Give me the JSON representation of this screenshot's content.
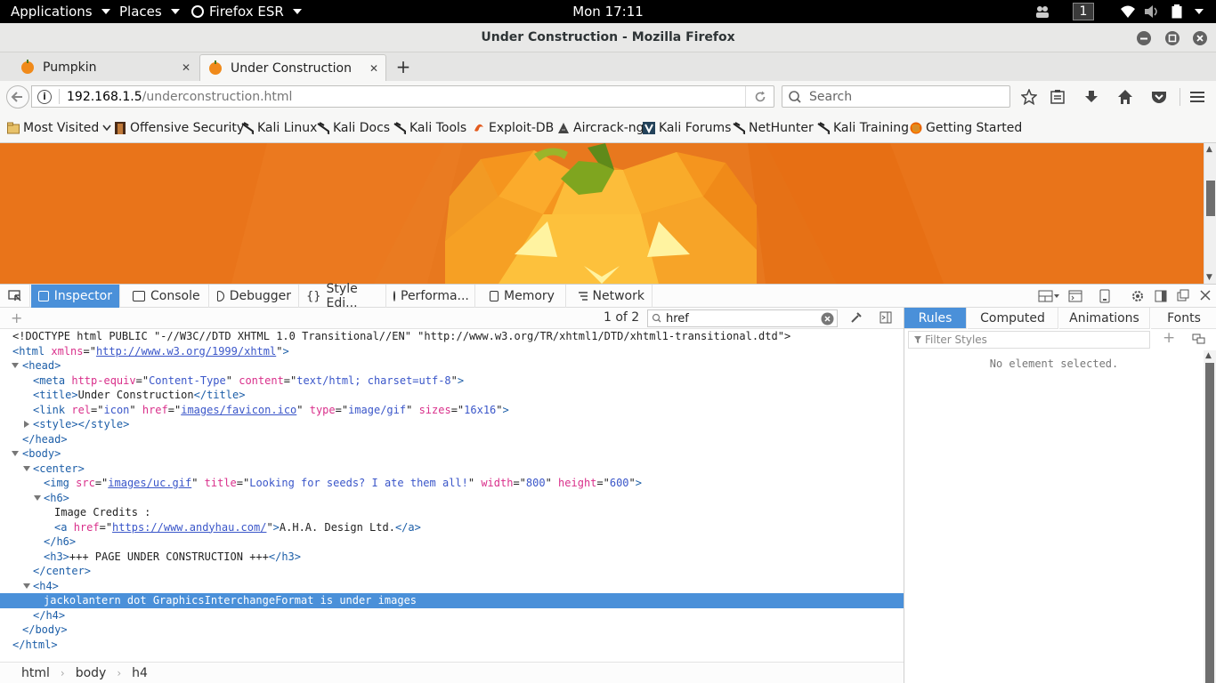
{
  "gnome": {
    "applications": "Applications",
    "places": "Places",
    "firefox_menu": "Firefox ESR",
    "clock": "Mon 17:11",
    "workspace": "1"
  },
  "window": {
    "title": "Under Construction - Mozilla Firefox"
  },
  "tabs": [
    {
      "label": "Pumpkin",
      "active": false
    },
    {
      "label": "Under Construction",
      "active": true
    }
  ],
  "navbar": {
    "url_host": "192.168.1.5",
    "url_path": "/underconstruction.html",
    "search_placeholder": "Search"
  },
  "bookmarks": [
    {
      "label": "Most Visited",
      "icon": "folder-icon"
    },
    {
      "label": "Offensive Security",
      "icon": "offsec-icon"
    },
    {
      "label": "Kali Linux",
      "icon": "kali-icon"
    },
    {
      "label": "Kali Docs",
      "icon": "kali-icon"
    },
    {
      "label": "Kali Tools",
      "icon": "kali-icon"
    },
    {
      "label": "Exploit-DB",
      "icon": "exploitdb-icon"
    },
    {
      "label": "Aircrack-ng",
      "icon": "aircrack-icon"
    },
    {
      "label": "Kali Forums",
      "icon": "kali-forums-icon"
    },
    {
      "label": "NetHunter",
      "icon": "kali-icon"
    },
    {
      "label": "Kali Training",
      "icon": "kali-icon"
    },
    {
      "label": "Getting Started",
      "icon": "firefox-icon"
    }
  ],
  "devtools": {
    "tabs": [
      "Inspector",
      "Console",
      "Debugger",
      "Style Edi...",
      "Performa...",
      "Memory",
      "Network"
    ],
    "search_count": "1 of 2",
    "search_value": "href",
    "markup": {
      "doctype": "<!DOCTYPE html PUBLIC \"-//W3C//DTD XHTML 1.0 Transitional//EN\" \"http://www.w3.org/TR/xhtml1/DTD/xhtml1-transitional.dtd\">",
      "html_xmlns": "http://www.w3.org/1999/xhtml",
      "meta_http_equiv": "Content-Type",
      "meta_content": "text/html; charset=utf-8",
      "title_text": "Under Construction",
      "link_rel": "icon",
      "link_href": "images/favicon.ico",
      "link_type": "image/gif",
      "link_sizes": "16x16",
      "img_src": "images/uc.gif",
      "img_title": "Looking for seeds? I ate them all!",
      "img_width": "800",
      "img_height": "600",
      "h6_text": "Image Credits :",
      "a_href": "https://www.andyhau.com/",
      "a_text": "A.H.A. Design Ltd.",
      "h3_text": "+++ PAGE UNDER CONSTRUCTION +++",
      "h4_text": "jackolantern dot GraphicsInterchangeFormat is under images"
    },
    "breadcrumbs": [
      "html",
      "body",
      "h4"
    ],
    "side_tabs": [
      "Rules",
      "Computed",
      "Animations",
      "Fonts"
    ],
    "filter_placeholder": "Filter Styles",
    "no_element": "No element selected."
  }
}
